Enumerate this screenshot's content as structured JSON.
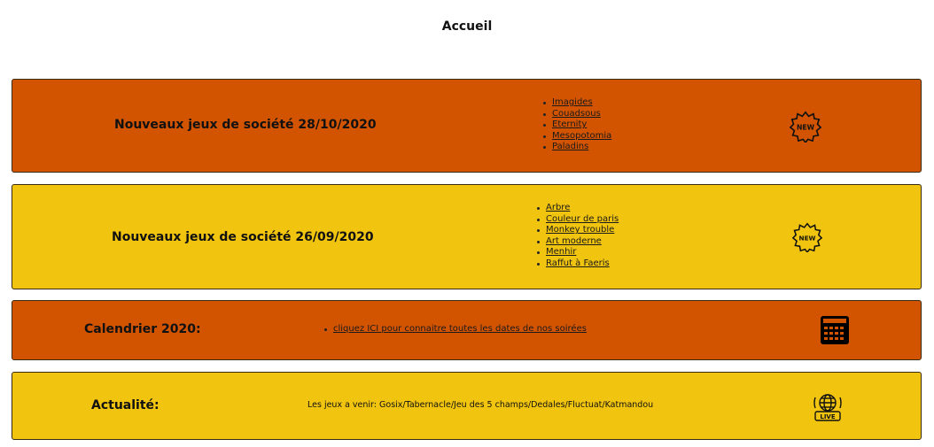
{
  "header": {
    "title": "Accueil"
  },
  "panels": [
    {
      "title": "Nouveaux jeux de société 28/10/2020",
      "games": [
        "Imagides",
        "Couadsous",
        "Eternity",
        "Mesopotomia",
        "Paladins"
      ],
      "icon": "new-badge-icon",
      "icon_text": "NEW"
    },
    {
      "title": "Nouveaux jeux de société 26/09/2020",
      "games": [
        "Arbre",
        "Couleur de paris",
        "Monkey trouble",
        "Art moderne",
        "Menhir",
        "Raffut à Faeris"
      ],
      "icon": "new-badge-icon",
      "icon_text": "NEW"
    },
    {
      "title": "Calendrier 2020:",
      "link": "cliquez ICI pour connaitre toutes les dates de nos soirées",
      "icon": "calendar-icon"
    },
    {
      "title": "Actualité:",
      "text": "Les jeux a venir: Gosix/Tabernacle/Jeu des 5 champs/Dedales/Fluctuat/Katmandou",
      "icon": "live-globe-icon",
      "icon_text": "LIVE"
    }
  ],
  "colors": {
    "orange": "#d35400",
    "yellow": "#f1c40f"
  }
}
